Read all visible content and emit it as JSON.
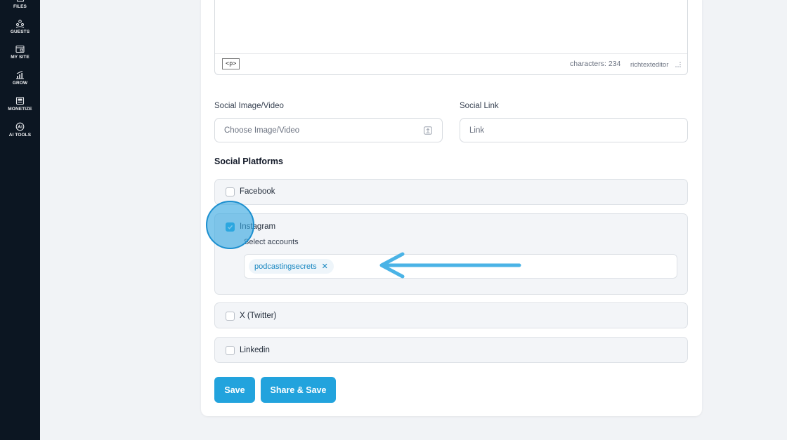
{
  "sidebar": {
    "items": [
      {
        "label": "FILES",
        "icon": "files-icon"
      },
      {
        "label": "GUESTS",
        "icon": "guests-icon"
      },
      {
        "label": "MY SITE",
        "icon": "my-site-icon"
      },
      {
        "label": "GROW",
        "icon": "grow-icon"
      },
      {
        "label": "MONETIZE",
        "icon": "monetize-icon"
      },
      {
        "label": "AI TOOLS",
        "icon": "ai-tools-icon"
      }
    ]
  },
  "editor": {
    "tag": "<p>",
    "characters": "characters: 234",
    "editor_name": "richtexteditor"
  },
  "social_image": {
    "label": "Social Image/Video",
    "placeholder": "Choose Image/Video"
  },
  "social_link": {
    "label": "Social Link",
    "placeholder": "Link"
  },
  "platforms": {
    "title": "Social Platforms",
    "facebook": {
      "label": "Facebook",
      "checked": false
    },
    "instagram": {
      "label": "Instagram",
      "checked": true,
      "select_label": "Select accounts",
      "accounts": [
        "podcastingsecrets"
      ]
    },
    "twitter": {
      "label": "X (Twitter)",
      "checked": false
    },
    "linkedin": {
      "label": "Linkedin",
      "checked": false
    }
  },
  "buttons": {
    "save": "Save",
    "share_save": "Share & Save"
  },
  "colors": {
    "accent": "#22a3dd",
    "sidebar_bg": "#0c1622",
    "page_bg": "#f1f3f6",
    "annotation": "#4ab3e6"
  }
}
